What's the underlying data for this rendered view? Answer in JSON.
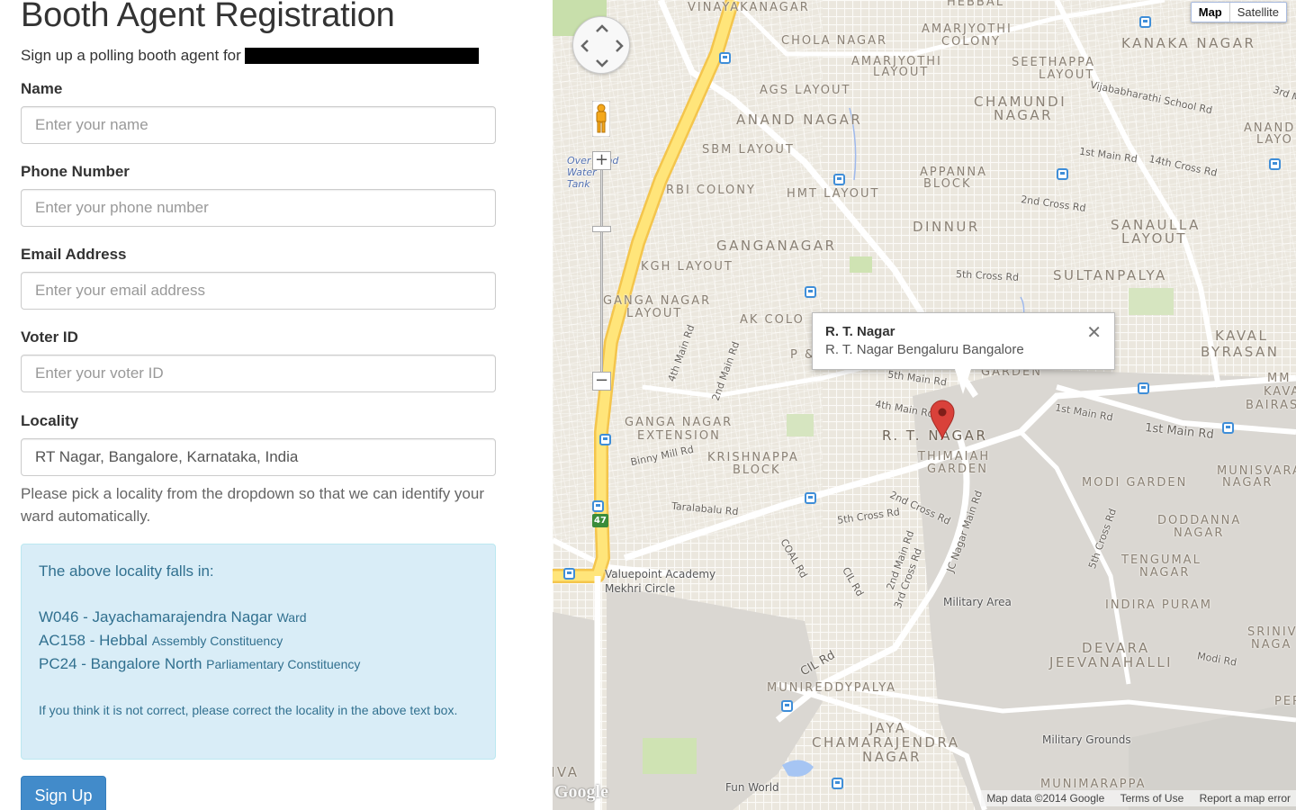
{
  "form": {
    "title": "Booth Agent Registration",
    "subtitle": "Sign up a polling booth agent for",
    "fields": [
      {
        "label": "Name",
        "placeholder": "Enter your name",
        "value": ""
      },
      {
        "label": "Phone Number",
        "placeholder": "Enter your phone number",
        "value": ""
      },
      {
        "label": "Email Address",
        "placeholder": "Enter your email address",
        "value": ""
      },
      {
        "label": "Voter ID",
        "placeholder": "Enter your voter ID",
        "value": ""
      },
      {
        "label": "Locality",
        "placeholder": "",
        "value": "RT Nagar, Bangalore, Karnataka, India"
      }
    ],
    "help_text": "Please pick a locality from the dropdown so that we can identify your ward automatically.",
    "ward_box": {
      "heading": "The above locality falls in:",
      "ward": {
        "main": "W046 - Jayachamarajendra Nagar",
        "suffix": "Ward"
      },
      "assembly": {
        "main": "AC158 - Hebbal",
        "suffix": "Assembly Constituency"
      },
      "parliament": {
        "main": "PC24 - Bangalore North",
        "suffix": "Parliamentary Constituency"
      },
      "note": "If you think it is not correct, please correct the locality in the above text box."
    },
    "signup_label": "Sign Up"
  },
  "map": {
    "type_controls": {
      "map": "Map",
      "satellite": "Satellite"
    },
    "infowindow": {
      "title": "R. T. Nagar",
      "subtitle": "R. T. Nagar Bengaluru Bangalore"
    },
    "attribution": {
      "data": "Map data ©2014 Google",
      "terms": "Terms of Use",
      "report": "Report a map error"
    },
    "logo": "Google",
    "area_labels": [
      "VINAYAKANAGAR",
      "HEBBAL",
      "AMARJYOTHI",
      "COLONY",
      "CHOLA NAGAR",
      "AMARJYOTHI",
      "LAYOUT",
      "KANAKA NAGAR",
      "SEETHAPPA",
      "LAYOUT",
      "AGS LAYOUT",
      "CHAMUNDI",
      "NAGAR",
      "ANAND NAGAR",
      "ANAND",
      "LAYO",
      "SBM LAYOUT",
      "APPANNA",
      "BLOCK",
      "RBI COLONY",
      "HMT LAYOUT",
      "DINNUR",
      "SANAULLA",
      "LAYOUT",
      "GANGANAGAR",
      "KGH LAYOUT",
      "SULTANPALYA",
      "GANGA NAGAR",
      "LAYOUT",
      "AK COLO",
      "KAVAL",
      "BYRASAN",
      "GARDEN",
      "MM",
      "KAVA",
      "BAIRASA",
      "GANGA NAGAR",
      "EXTENSION",
      "KRISHNAPPA",
      "BLOCK",
      "R. T. NAGAR",
      "THIMAIAH",
      "GARDEN",
      "MODI GARDEN",
      "MUNISVARA",
      "NAGAR",
      "DODDANNA",
      "NAGAR",
      "TENGUMAL",
      "NAGAR",
      "INDIRA PURAM",
      "SRINIVA",
      "NAGA",
      "DEVARA",
      "JEEVANAHALLI",
      "MUNIREDDYPALYA",
      "PERI",
      "JAYA",
      "CHAMARAJENDRA",
      "NAGAR",
      "MUNIMARAPPA",
      "IVA",
      "P &"
    ],
    "road_labels": [
      "Vijababharathi School Rd",
      "3rd M",
      "1st Main Rd",
      "14th Cross Rd",
      "2nd Cross Rd",
      "5th Cross Rd",
      "4th Main Rd",
      "2nd Main Rd",
      "5th Main Rd",
      "4th Main Rd",
      "1st Main Rd",
      "1st Main Rd",
      "Binny Mill Rd",
      "Taralabalu Rd",
      "2nd Cross Rd",
      "5th Cross Rd",
      "JC Nagar Main Rd",
      "5th Cross Rd",
      "2nd Main Rd",
      "3rd Cross Rd",
      "COAL Rd",
      "CIL Rd",
      "CIL Rd",
      "Modi Rd"
    ],
    "poi_labels": [
      "Over head Water Tank",
      "Valuepoint Academy",
      "Mekhri Circle",
      "Military Area",
      "Military Grounds",
      "Fun World"
    ],
    "highway_shield": "47"
  }
}
